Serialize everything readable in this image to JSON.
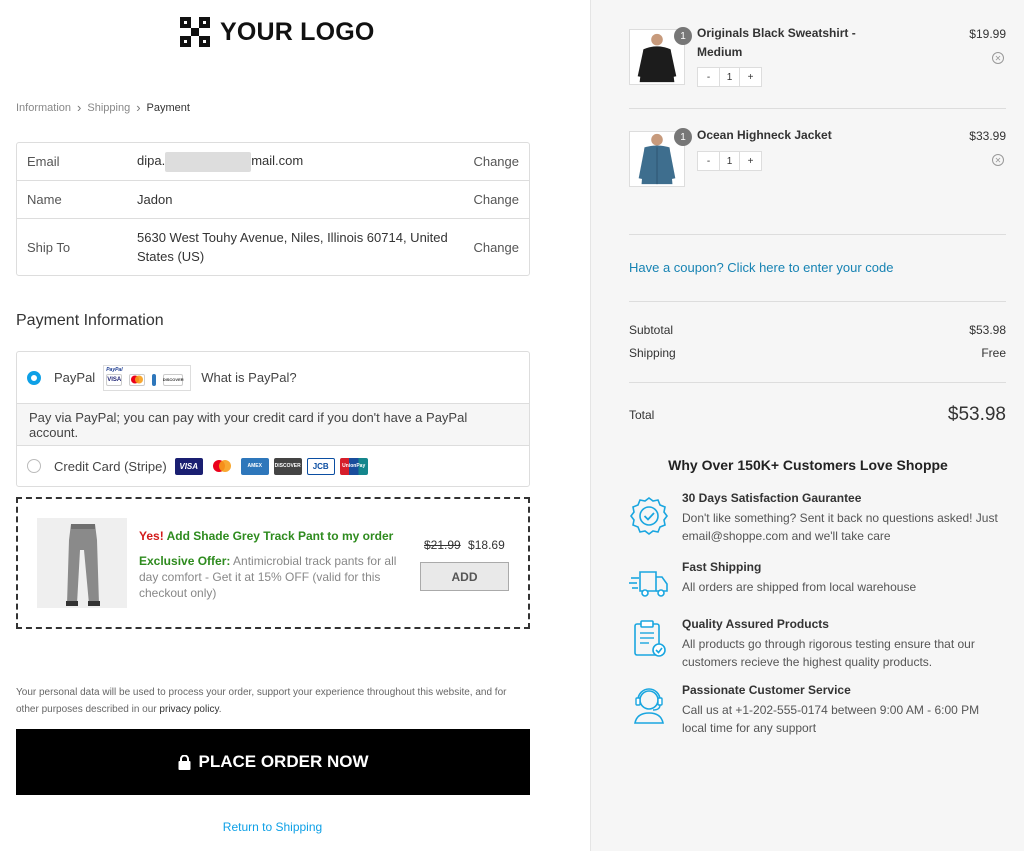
{
  "logo": {
    "text": "YOUR LOGO"
  },
  "breadcrumb": {
    "step1": "Information",
    "step2": "Shipping",
    "step3": "Payment"
  },
  "review": {
    "email": {
      "label": "Email",
      "value_prefix": "dipa.",
      "value_suffix": "mail.com",
      "action": "Change"
    },
    "name": {
      "label": "Name",
      "value": "Jadon",
      "action": "Change"
    },
    "ship_to": {
      "label": "Ship To",
      "value": "5630 West Touhy Avenue, Niles, Illinois 60714, United States (US)",
      "action": "Change"
    }
  },
  "payment": {
    "title": "Payment Information",
    "paypal": {
      "label": "PayPal",
      "what_is": "What is PayPal?",
      "selected": true,
      "logo_text": "PayPal",
      "cards": [
        "VISA",
        "MC",
        "AMEX",
        "DISCOVER"
      ]
    },
    "paypal_desc": "Pay via PayPal; you can pay with your credit card if you don't have a PayPal account.",
    "stripe": {
      "label": "Credit Card (Stripe)",
      "selected": false,
      "cards": [
        "VISA",
        "",
        "AMEX",
        "DISCOVER",
        "JCB",
        "UnionPay"
      ]
    }
  },
  "upsell": {
    "yes": "Yes!",
    "title": "Add Shade Grey Track Pant to my order",
    "offer_label": "Exclusive Offer:",
    "offer_text": "Antimicrobial track pants for all day comfort - Get it at 15% OFF (valid for this checkout only)",
    "old_price": "$21.99",
    "new_price": "$18.69",
    "add_label": "ADD"
  },
  "privacy": {
    "text": "Your personal data will be used to process your order, support your experience throughout this website, and for other purposes described in our",
    "link": "privacy policy",
    "end": "."
  },
  "place_order": {
    "label": "PLACE ORDER NOW"
  },
  "return_link": "Return to Shipping",
  "cart": {
    "items": [
      {
        "name": "Originals Black Sweatshirt - Medium",
        "price": "$19.99",
        "qty": "1",
        "badge": "1",
        "minus": "-",
        "plus": "+"
      },
      {
        "name": "Ocean Highneck Jacket",
        "price": "$33.99",
        "qty": "1",
        "badge": "1",
        "minus": "-",
        "plus": "+"
      }
    ],
    "coupon": "Have a coupon? Click here to enter your code",
    "subtotal": {
      "label": "Subtotal",
      "value": "$53.98"
    },
    "shipping": {
      "label": "Shipping",
      "value": "Free"
    },
    "total": {
      "label": "Total",
      "value": "$53.98"
    }
  },
  "why": {
    "title": "Why Over 150K+ Customers Love Shoppe",
    "benefits": [
      {
        "icon": "badge-check-icon",
        "title": "30 Days Satisfaction Gaurantee",
        "text": "Don't like something? Sent it back no questions asked! Just email@shoppe.com and we'll take care"
      },
      {
        "icon": "truck-icon",
        "title": "Fast Shipping",
        "text": "All orders are shipped from local warehouse"
      },
      {
        "icon": "clipboard-check-icon",
        "title": "Quality Assured Products",
        "text": "All products go through rigorous testing ensure that our customers recieve the highest quality products."
      },
      {
        "icon": "support-agent-icon",
        "title": "Passionate Customer Service",
        "text": "Call us at +1-202-555-0174 between 9:00 AM - 6:00 PM local time for any support"
      }
    ]
  },
  "colors": {
    "accent": "#0ea0e6",
    "link": "#1783b3",
    "offer_green": "#2e8b1e",
    "yes_red": "#d21a1a",
    "icon_blue": "#1aa6e0"
  }
}
